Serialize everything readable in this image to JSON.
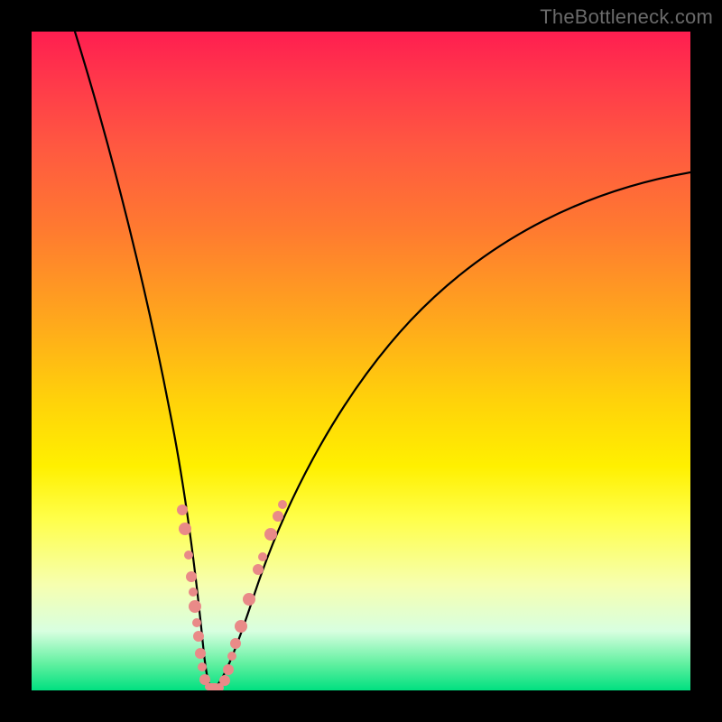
{
  "watermark": "TheBottleneck.com",
  "colors": {
    "frame": "#000000",
    "curve": "#000000",
    "dots": "#e98a88",
    "gradient_top": "#ff1e50",
    "gradient_bottom": "#00e080"
  },
  "chart_data": {
    "type": "line",
    "title": "",
    "xlabel": "",
    "ylabel": "",
    "xlim": [
      0,
      100
    ],
    "ylim": [
      0,
      100
    ],
    "grid": false,
    "legend": false,
    "note": "V-shaped bottleneck curve; background gradient encodes severity (red=high, green=low). Values are read off pixel positions since no axes are labeled.",
    "series": [
      {
        "name": "left_branch",
        "x": [
          6.6,
          10.4,
          14.1,
          17.2,
          19.9,
          22.3,
          24.0,
          25.3,
          26.2,
          26.9
        ],
        "y": [
          100,
          84.1,
          68.2,
          52.4,
          36.6,
          20.8,
          10.0,
          3.2,
          0.4,
          0.0
        ]
      },
      {
        "name": "right_branch",
        "x": [
          26.9,
          28.4,
          30.1,
          32.9,
          36.3,
          41.1,
          47.9,
          56.2,
          65.8,
          78.1,
          89.0,
          100.0
        ],
        "y": [
          0.0,
          0.3,
          2.5,
          9.2,
          18.1,
          28.5,
          40.3,
          51.3,
          60.4,
          69.2,
          74.5,
          78.4
        ]
      }
    ],
    "markers": [
      {
        "branch": "left",
        "x": 22.9,
        "y": 27.4
      },
      {
        "branch": "left",
        "x": 23.3,
        "y": 24.5
      },
      {
        "branch": "left",
        "x": 23.8,
        "y": 20.5
      },
      {
        "branch": "left",
        "x": 24.2,
        "y": 17.3
      },
      {
        "branch": "left",
        "x": 24.5,
        "y": 14.9
      },
      {
        "branch": "left",
        "x": 24.8,
        "y": 12.7
      },
      {
        "branch": "left",
        "x": 25.1,
        "y": 10.3
      },
      {
        "branch": "left",
        "x": 25.3,
        "y": 8.2
      },
      {
        "branch": "left",
        "x": 25.6,
        "y": 5.6
      },
      {
        "branch": "left",
        "x": 25.9,
        "y": 3.6
      },
      {
        "branch": "left",
        "x": 26.2,
        "y": 1.5
      },
      {
        "branch": "left",
        "x": 26.7,
        "y": 0.3
      },
      {
        "branch": "left",
        "x": 27.5,
        "y": 0.0
      },
      {
        "branch": "right",
        "x": 28.5,
        "y": 0.3
      },
      {
        "branch": "right",
        "x": 29.3,
        "y": 1.5
      },
      {
        "branch": "right",
        "x": 29.9,
        "y": 3.2
      },
      {
        "branch": "right",
        "x": 30.4,
        "y": 5.2
      },
      {
        "branch": "right",
        "x": 31.0,
        "y": 7.1
      },
      {
        "branch": "right",
        "x": 31.8,
        "y": 9.7
      },
      {
        "branch": "right",
        "x": 33.0,
        "y": 13.8
      },
      {
        "branch": "right",
        "x": 34.4,
        "y": 18.4
      },
      {
        "branch": "right",
        "x": 35.1,
        "y": 20.3
      },
      {
        "branch": "right",
        "x": 36.3,
        "y": 23.8
      },
      {
        "branch": "right",
        "x": 37.4,
        "y": 26.4
      },
      {
        "branch": "right",
        "x": 38.1,
        "y": 28.2
      }
    ]
  }
}
